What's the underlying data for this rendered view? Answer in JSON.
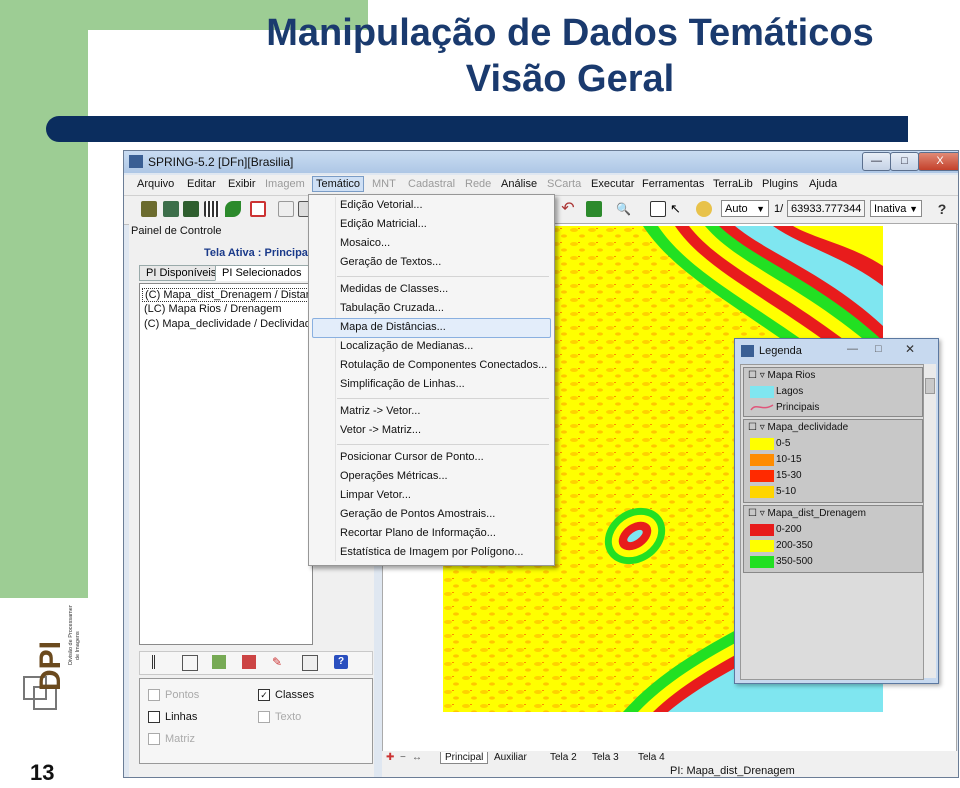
{
  "slide": {
    "title_line1": "Manipulação de Dados Temáticos",
    "title_line2": "Visão Geral",
    "page_number": "13",
    "logo_text": "DPI",
    "logo_subtitle": "Divisão de Processamento de Imagens"
  },
  "window": {
    "title": "SPRING-5.2 [DFn][Brasilia]",
    "buttons": {
      "minimize": "—",
      "maximize": "□",
      "close": "X"
    }
  },
  "menubar": {
    "items": [
      "Arquivo",
      "Editar",
      "Exibir",
      "Imagem",
      "Temático",
      "MNT",
      "Cadastral",
      "Rede",
      "Análise",
      "SCarta",
      "Executar",
      "Ferramentas",
      "TerraLib",
      "Plugins",
      "Ajuda"
    ],
    "disabled": [
      "Imagem",
      "MNT",
      "Cadastral",
      "Rede",
      "SCarta"
    ],
    "selected": "Temático"
  },
  "toolbar": {
    "auto_combo": "Auto",
    "scale_prefix": "1/",
    "scale_value": "63933.777344",
    "state_combo": "Inativa",
    "help_icon": "question-mark-icon"
  },
  "control_panel": {
    "title": "Painel de Controle",
    "active_screen": "Tela Ativa : Principal",
    "tabs": [
      "PI Disponíveis",
      "PI Selecionados"
    ],
    "active_tab": "PI Selecionados",
    "pi_list": [
      "(C) Mapa_dist_Drenagem / Distancia",
      "(LC) Mapa Rios / Drenagem",
      "(C) Mapa_declividade / Declividade"
    ],
    "options": [
      {
        "label": "Pontos",
        "checked": false,
        "enabled": false
      },
      {
        "label": "Classes",
        "checked": true,
        "enabled": true
      },
      {
        "label": "Linhas",
        "checked": false,
        "enabled": true
      },
      {
        "label": "Texto",
        "checked": false,
        "enabled": false
      },
      {
        "label": "Matriz",
        "checked": false,
        "enabled": false
      }
    ]
  },
  "tematico_menu": {
    "items": [
      "Edição Vetorial...",
      "Edição Matricial...",
      "Mosaico...",
      "Geração de Textos...",
      "Medidas de Classes...",
      "Tabulação Cruzada...",
      "Mapa de Distâncias...",
      "Localização de Medianas...",
      "Rotulação de Componentes Conectados...",
      "Simplificação de Linhas...",
      "Matriz -> Vetor...",
      "Vetor -> Matriz...",
      "Posicionar Cursor de Ponto...",
      "Operações Métricas...",
      "Limpar Vetor...",
      "Geração de Pontos Amostrais...",
      "Recortar Plano de Informação...",
      "Estatística de Imagem por Polígono..."
    ],
    "highlighted": "Mapa de Distâncias..."
  },
  "legend": {
    "title": "Legenda",
    "groups": [
      {
        "name": "Mapa Rios",
        "entries": [
          {
            "label": "Lagos",
            "color": "#7fe6f0"
          },
          {
            "label": "Principais",
            "color": "#e0557a"
          }
        ]
      },
      {
        "name": "Mapa_declividade",
        "entries": [
          {
            "label": "0-5",
            "color": "#ffff00"
          },
          {
            "label": "10-15",
            "color": "#ff8c00"
          },
          {
            "label": "15-30",
            "color": "#ff2a00"
          },
          {
            "label": "5-10",
            "color": "#ffd500"
          }
        ]
      },
      {
        "name": "Mapa_dist_Drenagem",
        "entries": [
          {
            "label": "0-200",
            "color": "#e81c1c"
          },
          {
            "label": "200-350",
            "color": "#ffff00"
          },
          {
            "label": "350-500",
            "color": "#22e022"
          }
        ]
      }
    ]
  },
  "status": {
    "tabs": [
      "Principal",
      "Auxiliar",
      "Tela 2",
      "Tela 3",
      "Tela 4"
    ],
    "active_tab": "Principal",
    "pi": "PI: Mapa_dist_Drenagem"
  }
}
